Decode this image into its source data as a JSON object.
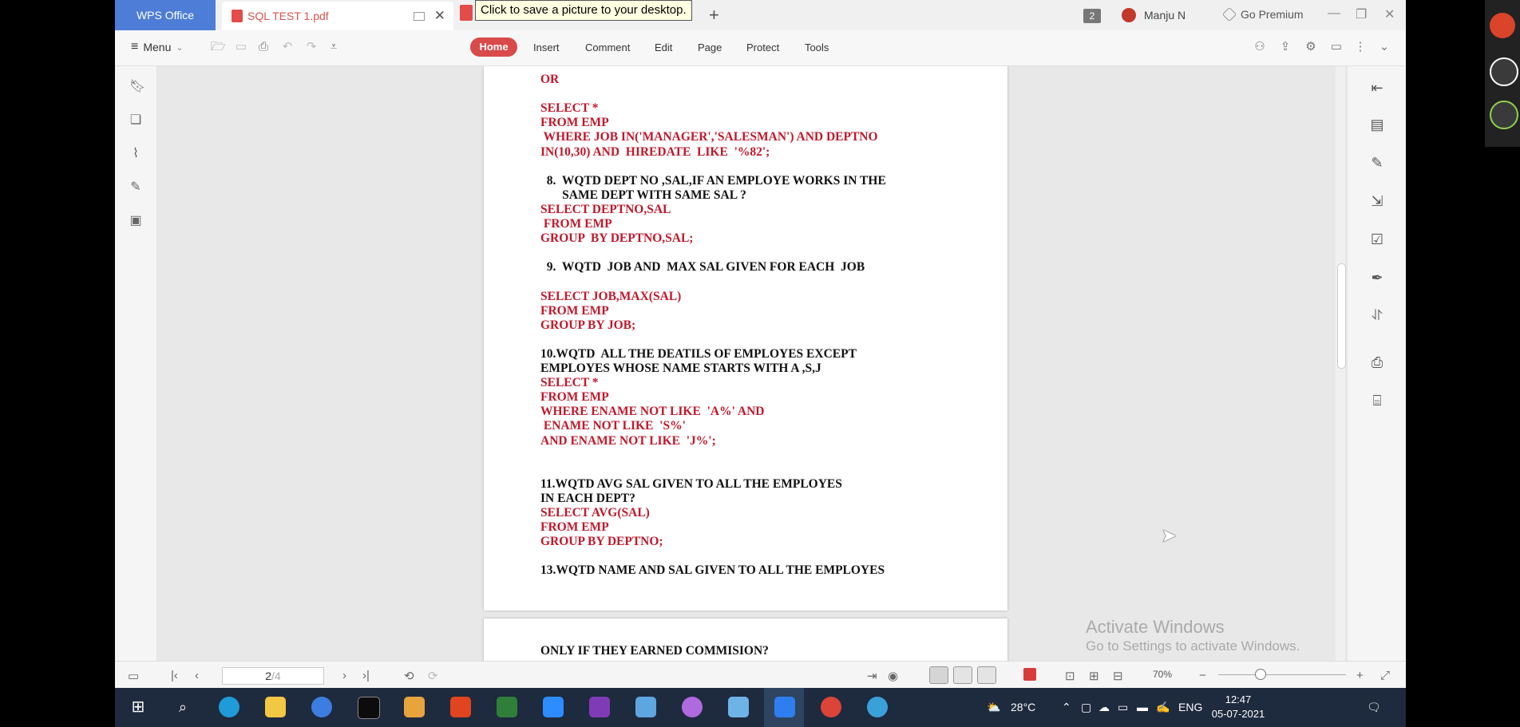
{
  "tabs": {
    "app_name": "WPS Office",
    "doc_title": "SQL TEST 1.pdf",
    "tooltip": "Click to save a picture to your desktop.",
    "tab_count": "2",
    "user": "Manju N",
    "premium": "Go Premium"
  },
  "toolbar": {
    "menu_label": "Menu",
    "tabs": [
      "Home",
      "Insert",
      "Comment",
      "Edit",
      "Page",
      "Protect",
      "Tools"
    ]
  },
  "document": {
    "page1_lines": [
      {
        "text": "OR",
        "color": "red",
        "indent": 0
      },
      {
        "text": "",
        "color": "red",
        "indent": 0
      },
      {
        "text": "SELECT *",
        "color": "red",
        "indent": 0
      },
      {
        "text": "FROM EMP",
        "color": "red",
        "indent": 0
      },
      {
        "text": " WHERE JOB IN('MANAGER','SALESMAN') AND DEPTNO",
        "color": "red",
        "indent": 0
      },
      {
        "text": "IN(10,30) AND  HIREDATE  LIKE  '%82';",
        "color": "red",
        "indent": 0
      },
      {
        "text": "",
        "color": "red",
        "indent": 0
      },
      {
        "text": "  8.  WQTD DEPT NO ,SAL,IF AN EMPLOYE WORKS IN THE",
        "color": "black",
        "indent": 0
      },
      {
        "text": "       SAME DEPT WITH SAME SAL ?",
        "color": "black",
        "indent": 0
      },
      {
        "text": "SELECT DEPTNO,SAL",
        "color": "red",
        "indent": 0
      },
      {
        "text": " FROM EMP",
        "color": "red",
        "indent": 0
      },
      {
        "text": "GROUP  BY DEPTNO,SAL;",
        "color": "red",
        "indent": 0
      },
      {
        "text": "",
        "color": "red",
        "indent": 0
      },
      {
        "text": "  9.  WQTD  JOB AND  MAX SAL GIVEN FOR EACH  JOB",
        "color": "black",
        "indent": 0
      },
      {
        "text": "",
        "color": "red",
        "indent": 0
      },
      {
        "text": "SELECT JOB,MAX(SAL)",
        "color": "red",
        "indent": 0
      },
      {
        "text": "FROM EMP",
        "color": "red",
        "indent": 0
      },
      {
        "text": "GROUP BY JOB;",
        "color": "red",
        "indent": 0
      },
      {
        "text": "",
        "color": "red",
        "indent": 0
      },
      {
        "text": "10.WQTD  ALL THE DEATILS OF EMPLOYES EXCEPT",
        "color": "black",
        "indent": 0
      },
      {
        "text": "EMPLOYES WHOSE NAME STARTS WITH A ,S,J",
        "color": "black",
        "indent": 0
      },
      {
        "text": "SELECT *",
        "color": "red",
        "indent": 0
      },
      {
        "text": "FROM EMP",
        "color": "red",
        "indent": 0
      },
      {
        "text": "WHERE ENAME NOT LIKE  'A%' AND",
        "color": "red",
        "indent": 0
      },
      {
        "text": " ENAME NOT LIKE  'S%'",
        "color": "red",
        "indent": 0
      },
      {
        "text": "AND ENAME NOT LIKE  'J%';",
        "color": "red",
        "indent": 0
      },
      {
        "text": "",
        "color": "red",
        "indent": 0
      },
      {
        "text": "",
        "color": "red",
        "indent": 0
      },
      {
        "text": "11.WQTD AVG SAL GIVEN TO ALL THE EMPLOYES",
        "color": "black",
        "indent": 0
      },
      {
        "text": "IN EACH DEPT?",
        "color": "black",
        "indent": 0
      },
      {
        "text": "SELECT AVG(SAL)",
        "color": "red",
        "indent": 0
      },
      {
        "text": "FROM EMP",
        "color": "red",
        "indent": 0
      },
      {
        "text": "GROUP BY DEPTNO;",
        "color": "red",
        "indent": 0
      },
      {
        "text": "",
        "color": "red",
        "indent": 0
      },
      {
        "text": "13.WQTD NAME AND SAL GIVEN TO ALL THE EMPLOYES",
        "color": "black",
        "indent": 0
      }
    ],
    "page2_line": "ONLY IF THEY EARNED COMMISION?",
    "watermark_title": "Activate Windows",
    "watermark_sub": "Go to Settings to activate Windows."
  },
  "statusbar": {
    "page_current": "2",
    "page_total": "/4",
    "zoom": "70%"
  },
  "taskbar": {
    "temperature": "28°C",
    "language": "ENG",
    "time": "12:47",
    "date": "05-07-2021"
  },
  "colors": {
    "accent_red": "#d94a4a",
    "doc_red": "#c0182b",
    "wps_blue": "#4d7dd6",
    "taskbar": "#1e2a3e"
  }
}
